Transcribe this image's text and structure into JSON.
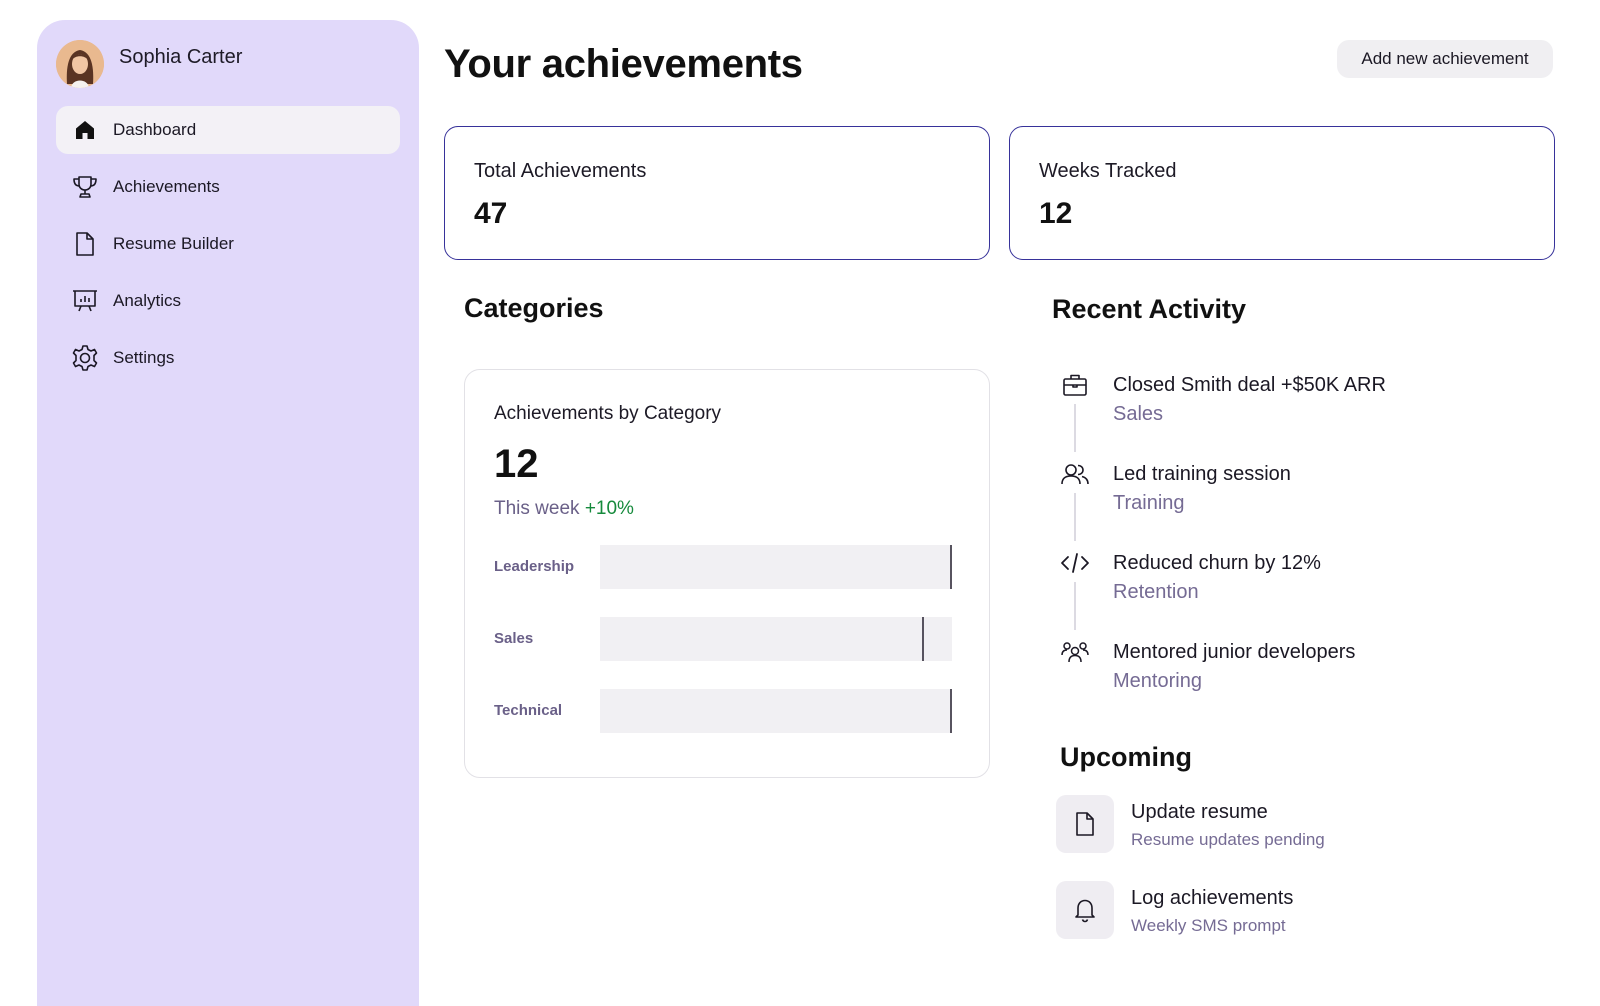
{
  "user": {
    "name": "Sophia Carter"
  },
  "sidebar": {
    "items": [
      {
        "label": "Dashboard",
        "icon": "home-icon",
        "active": true
      },
      {
        "label": "Achievements",
        "icon": "trophy-icon",
        "active": false
      },
      {
        "label": "Resume Builder",
        "icon": "document-icon",
        "active": false
      },
      {
        "label": "Analytics",
        "icon": "presentation-chart-icon",
        "active": false
      },
      {
        "label": "Settings",
        "icon": "gear-icon",
        "active": false
      }
    ]
  },
  "header": {
    "title": "Your achievements",
    "add_button": "Add new achievement"
  },
  "stats": [
    {
      "label": "Total Achievements",
      "value": "47"
    },
    {
      "label": "Weeks Tracked",
      "value": "12"
    }
  ],
  "categories": {
    "section_title": "Categories",
    "card_title": "Achievements by Category",
    "value": "12",
    "sub_label": "This week",
    "delta": "+10%",
    "bars": [
      {
        "label": "Leadership",
        "fraction": 1.0
      },
      {
        "label": "Sales",
        "fraction": 0.92
      },
      {
        "label": "Technical",
        "fraction": 1.0
      }
    ]
  },
  "recent_activity": {
    "title": "Recent Activity",
    "items": [
      {
        "title": "Closed Smith deal +$50K ARR",
        "category": "Sales",
        "icon": "briefcase-icon"
      },
      {
        "title": "Led training session",
        "category": "Training",
        "icon": "users-icon"
      },
      {
        "title": "Reduced churn by 12%",
        "category": "Retention",
        "icon": "code-icon"
      },
      {
        "title": "Mentored junior developers",
        "category": "Mentoring",
        "icon": "group-icon"
      }
    ]
  },
  "upcoming": {
    "title": "Upcoming",
    "items": [
      {
        "title": "Update resume",
        "subtitle": "Resume updates pending",
        "icon": "document-icon"
      },
      {
        "title": "Log achievements",
        "subtitle": "Weekly SMS prompt",
        "icon": "bell-icon"
      }
    ]
  },
  "colors": {
    "sidebar_bg": "#e1d9fa",
    "card_border": "#37329a",
    "accent_text": "#756b94",
    "delta_positive": "#168a3c"
  }
}
